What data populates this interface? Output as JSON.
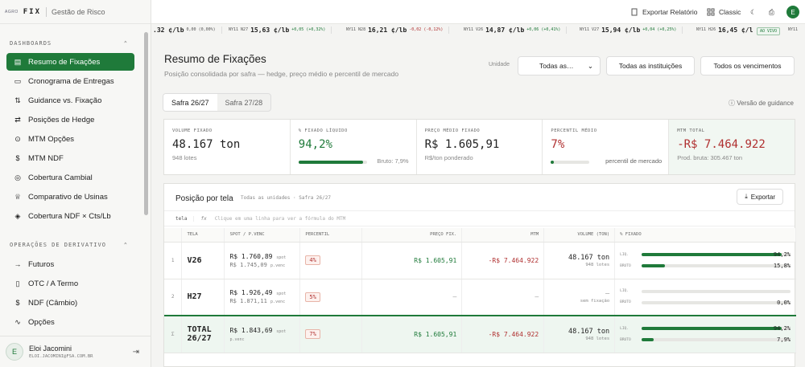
{
  "brand": {
    "logo": "AGRO",
    "name": "FIX",
    "sub": "Gestão de Risco"
  },
  "sidebar": {
    "sec1": "DASHBOARDS",
    "items1": [
      {
        "label": "Resumo de Fixações",
        "icon": "map-icon"
      },
      {
        "label": "Cronograma de Entregas",
        "icon": "truck-icon"
      },
      {
        "label": "Guidance vs. Fixação",
        "icon": "compare-icon"
      },
      {
        "label": "Posições de Hedge",
        "icon": "exchange-icon"
      },
      {
        "label": "MTM Opções",
        "icon": "dollar-circle-icon"
      },
      {
        "label": "MTM NDF",
        "icon": "dollar-icon"
      },
      {
        "label": "Cobertura Cambial",
        "icon": "coins-icon"
      },
      {
        "label": "Comparativo de Usinas",
        "icon": "trophy-icon"
      },
      {
        "label": "Cobertura NDF × Cts/Lb",
        "icon": "shield-icon"
      }
    ],
    "sec2": "OPERAÇÕES DE DERIVATIVO",
    "items2": [
      {
        "label": "Futuros",
        "icon": "arrow-right-icon"
      },
      {
        "label": "OTC / A Termo",
        "icon": "document-icon"
      },
      {
        "label": "NDF (Câmbio)",
        "icon": "dollar-icon"
      },
      {
        "label": "Opções",
        "icon": "pulse-icon"
      }
    ],
    "user": {
      "initial": "E",
      "name": "Eloi Jacomini",
      "email": "ELOI.JACOMINI@FSA.COM.BR"
    }
  },
  "topbar": {
    "export": "Exportar Relatório",
    "classic": "Classic",
    "avatar": "E"
  },
  "ticker": [
    {
      "name": "",
      "price": ".32 ¢/lb",
      "chg": "0,00 (0,00%)",
      "dir": "flat"
    },
    {
      "name": "NY11 N27",
      "price": "15,63 ¢/lb",
      "chg": "+0,05 (+0,32%)",
      "dir": "up"
    },
    {
      "name": "NY11 N28",
      "price": "16,21 ¢/lb",
      "chg": "-0,02 (-0,12%)",
      "dir": "dn"
    },
    {
      "name": "NY11 V26",
      "price": "14,87 ¢/lb",
      "chg": "+0,06 (+0,41%)",
      "dir": "up"
    },
    {
      "name": "NY11 V27",
      "price": "15,94 ¢/lb",
      "chg": "+0,04 (+0,25%)",
      "dir": "up"
    },
    {
      "name": "NY11 H26",
      "price": "16,45 ¢/l",
      "chg": "",
      "dir": "flat"
    }
  ],
  "live": "AO VIVO",
  "ticker_tail": "NY11",
  "page": {
    "title": "Resumo de Fixações",
    "subtitle": "Posição consolidada por safra — hedge, preço médio e percentil de mercado",
    "unit_label": "Unidade",
    "unit_value": "Todas as…",
    "inst": "Todas as instituições",
    "venc": "Todos os vencimentos",
    "tabs": [
      "Safra 26/27",
      "Safra 27/28"
    ],
    "guidance": "Versão de guidance"
  },
  "kpis": [
    {
      "label": "VOLUME FIXADO",
      "value": "48.167 ton",
      "sub": "948 lotes"
    },
    {
      "label": "% FIXADO LÍQUIDO",
      "value": "94,2%",
      "sub": "Bruto: 7,9%",
      "fill": 0.942
    },
    {
      "label": "PREÇO MÉDIO FIXADO",
      "value": "R$ 1.605,91",
      "sub": "R$/ton ponderado"
    },
    {
      "label": "PERCENTIL MÉDIO",
      "value": "7%",
      "sub": "percentil de mercado",
      "fill": 0.07
    },
    {
      "label": "MTM TOTAL",
      "value": "-R$ 7.464.922",
      "sub": "Prod. bruta: 305.467 ton"
    }
  ],
  "panel": {
    "title": "Posição por tela",
    "meta": "Todas as unidades · Safra 26/27",
    "export": "Exportar",
    "fx_label": "tela",
    "fx_icon": "fx",
    "fx_hint": "Clique em uma linha para ver a fórmula do MTM",
    "headers": [
      "",
      "TELA",
      "SPOT / P.VENC",
      "PERCENTIL",
      "PREÇO FIX.",
      "MTM",
      "VOLUME (TON)",
      "% FIXADO"
    ],
    "rows": [
      {
        "n": "1",
        "tela": "V26",
        "spot": "R$ 1.760,89",
        "spot_tag": "spot",
        "venc": "R$ 1.745,09",
        "venc_tag": "p.venc",
        "pct": "4%",
        "preco": "R$ 1.605,91",
        "mtm": "-R$ 7.464.922",
        "vol": "48.167 ton",
        "vol2": "948 lotes",
        "liq_label": "LIQ.",
        "liq": "94,2%",
        "liq_fill": 0.942,
        "bru_label": "BRUTO",
        "bru": "15,8%",
        "bru_fill": 0.158
      },
      {
        "n": "2",
        "tela": "H27",
        "spot": "R$ 1.926,49",
        "spot_tag": "spot",
        "venc": "R$ 1.871,11",
        "venc_tag": "p.venc",
        "pct": "5%",
        "preco": "—",
        "mtm": "—",
        "vol": "—",
        "vol2": "sem fixação",
        "liq_label": "LIQ.",
        "liq": "",
        "liq_fill": 0,
        "bru_label": "BRUTO",
        "bru": "0,0%",
        "bru_fill": 0
      },
      {
        "n": "Σ",
        "tela": "TOTAL 26/27",
        "spot": "R$ 1.843,69",
        "spot_tag": "spot",
        "venc": "",
        "venc_tag": "p.venc",
        "pct": "7%",
        "preco": "R$ 1.605,91",
        "mtm": "-R$ 7.464.922",
        "vol": "48.167 ton",
        "vol2": "948 lotes",
        "liq_label": "LIQ.",
        "liq": "94,2%",
        "liq_fill": 0.942,
        "bru_label": "BRUTO",
        "bru": "7,9%",
        "bru_fill": 0.079
      }
    ]
  }
}
